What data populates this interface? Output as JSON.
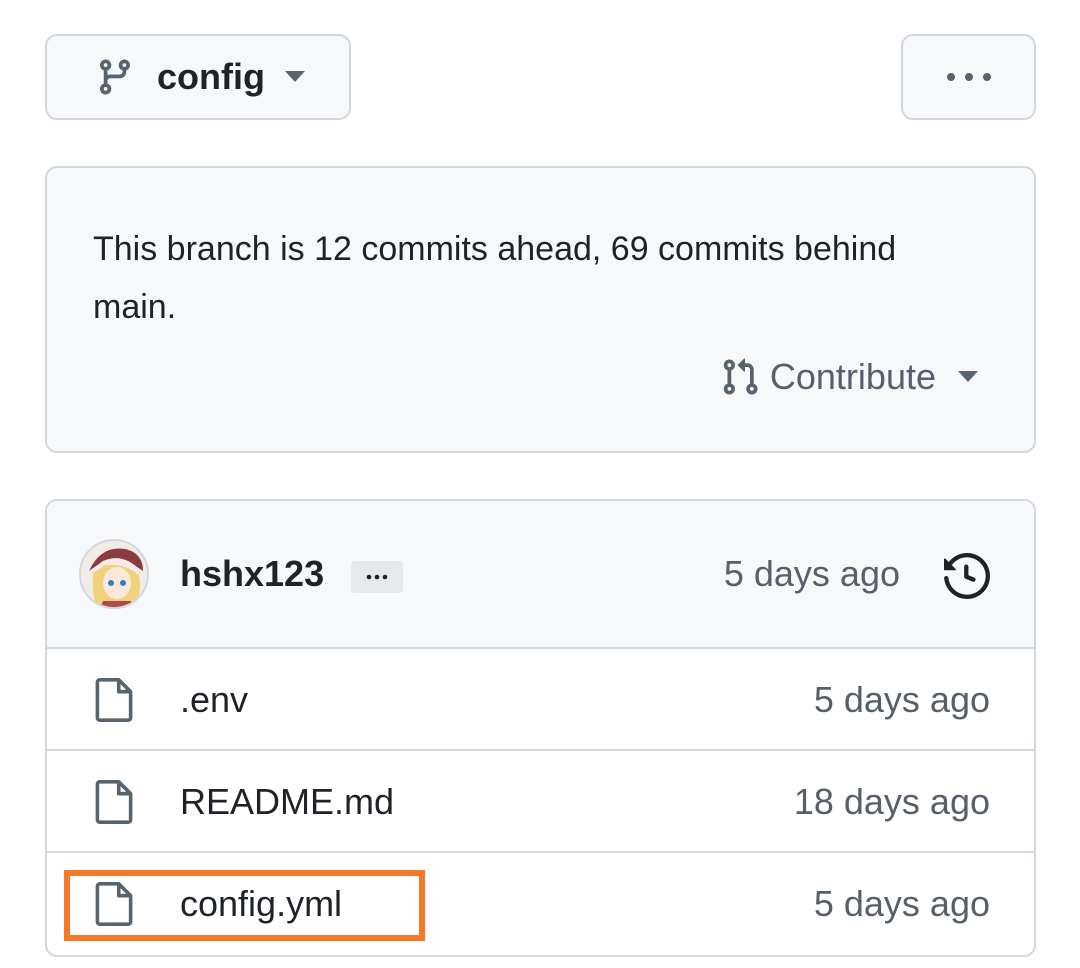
{
  "branch": {
    "name": "config",
    "icon": "git-branch-icon"
  },
  "more_button": {
    "icon": "kebab-horizontal-icon"
  },
  "branch_info": {
    "status_text": "This branch is 12 commits ahead, 69 commits behind main.",
    "contribute_label": "Contribute"
  },
  "latest_commit": {
    "author": "hshx123",
    "time": "5 days ago",
    "history_icon": "history-icon"
  },
  "files": [
    {
      "name": ".env",
      "time": "5 days ago",
      "icon": "file-icon"
    },
    {
      "name": "README.md",
      "time": "18 days ago",
      "icon": "file-icon"
    },
    {
      "name": "config.yml",
      "time": "5 days ago",
      "icon": "file-icon",
      "highlighted": true
    }
  ],
  "colors": {
    "border": "#d0d7de",
    "muted_bg": "#f6f8fa",
    "text": "#1f2328",
    "muted_text": "#57606a",
    "highlight": "#f47a2a"
  }
}
